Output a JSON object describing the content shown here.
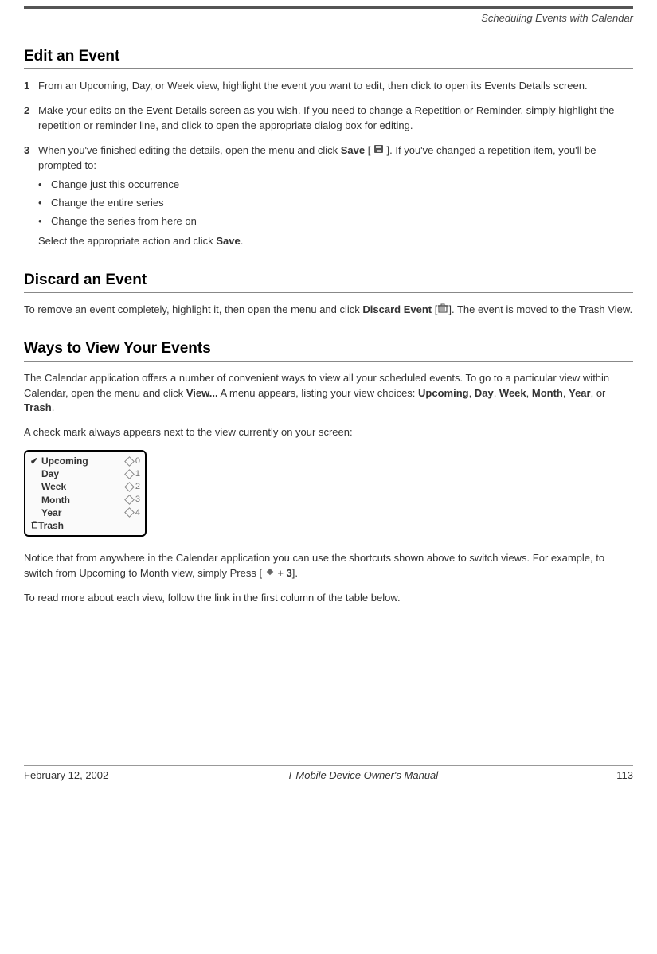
{
  "running_head": "Scheduling Events with Calendar",
  "h_edit": "Edit an Event",
  "steps": {
    "s1": {
      "num": "1",
      "text": "From an Upcoming, Day, or Week view, highlight the event you want to edit, then click to open its Events Details screen."
    },
    "s2": {
      "num": "2",
      "text": "Make your edits on the Event Details screen as you wish. If you need to change a Repetition or Reminder, simply highlight the repetition or reminder line, and click to open the appropriate dialog box for editing."
    },
    "s3": {
      "num": "3",
      "pre": "When you've finished editing the details, open the menu and click ",
      "boldSave": "Save",
      "mid": " [ ",
      "post_bracket": " ]. If you've changed a repetition item, you'll be prompted to:",
      "b1": "Change just this occurrence",
      "b2": "Change the entire series",
      "b3": "Change the series from here on",
      "tail_a": "Select the appropriate action and click ",
      "tail_b": "Save",
      "tail_c": "."
    }
  },
  "h_discard": "Discard an Event",
  "discard": {
    "a": "To remove an event completely, highlight it, then open the menu and click ",
    "b": "Discard Event",
    "c": " [",
    "d": "]. The event is moved to the Trash View."
  },
  "h_views": "Ways to View Your Events",
  "views_p1_a": "The Calendar application offers a number of convenient ways to view all your scheduled events. To go to a particular view within Calendar, open the menu and click ",
  "views_p1_view": "View...",
  "views_p1_b": " A menu appears, listing your view choices: ",
  "v_upcoming": "Upcoming",
  "v_day": "Day",
  "v_week": "Week",
  "v_month": "Month",
  "v_year": "Year",
  "v_or": ", or ",
  "v_trash": "Trash",
  "period": ".",
  "comma": ", ",
  "views_p2": "A check mark always appears next to the view currently on your screen:",
  "menu": {
    "items": [
      {
        "label": "Upcoming",
        "shortcut": "0",
        "checked": true
      },
      {
        "label": "Day",
        "shortcut": "1"
      },
      {
        "label": "Week",
        "shortcut": "2"
      },
      {
        "label": "Month",
        "shortcut": "3"
      },
      {
        "label": "Year",
        "shortcut": "4"
      },
      {
        "label": "Trash",
        "trash": true
      }
    ]
  },
  "views_p3_a": "Notice that from anywhere in the Calendar application you can use the shortcuts shown above to switch views. For example, to switch from Upcoming to Month view, simply Press [ ",
  "views_p3_b": " + ",
  "views_p3_c": "3",
  "views_p3_d": "].",
  "views_p4": "To read more about each view, follow the link in the first column of the table below.",
  "footer": {
    "date": "February 12, 2002",
    "title": "T-Mobile Device Owner's Manual",
    "page": "113"
  }
}
